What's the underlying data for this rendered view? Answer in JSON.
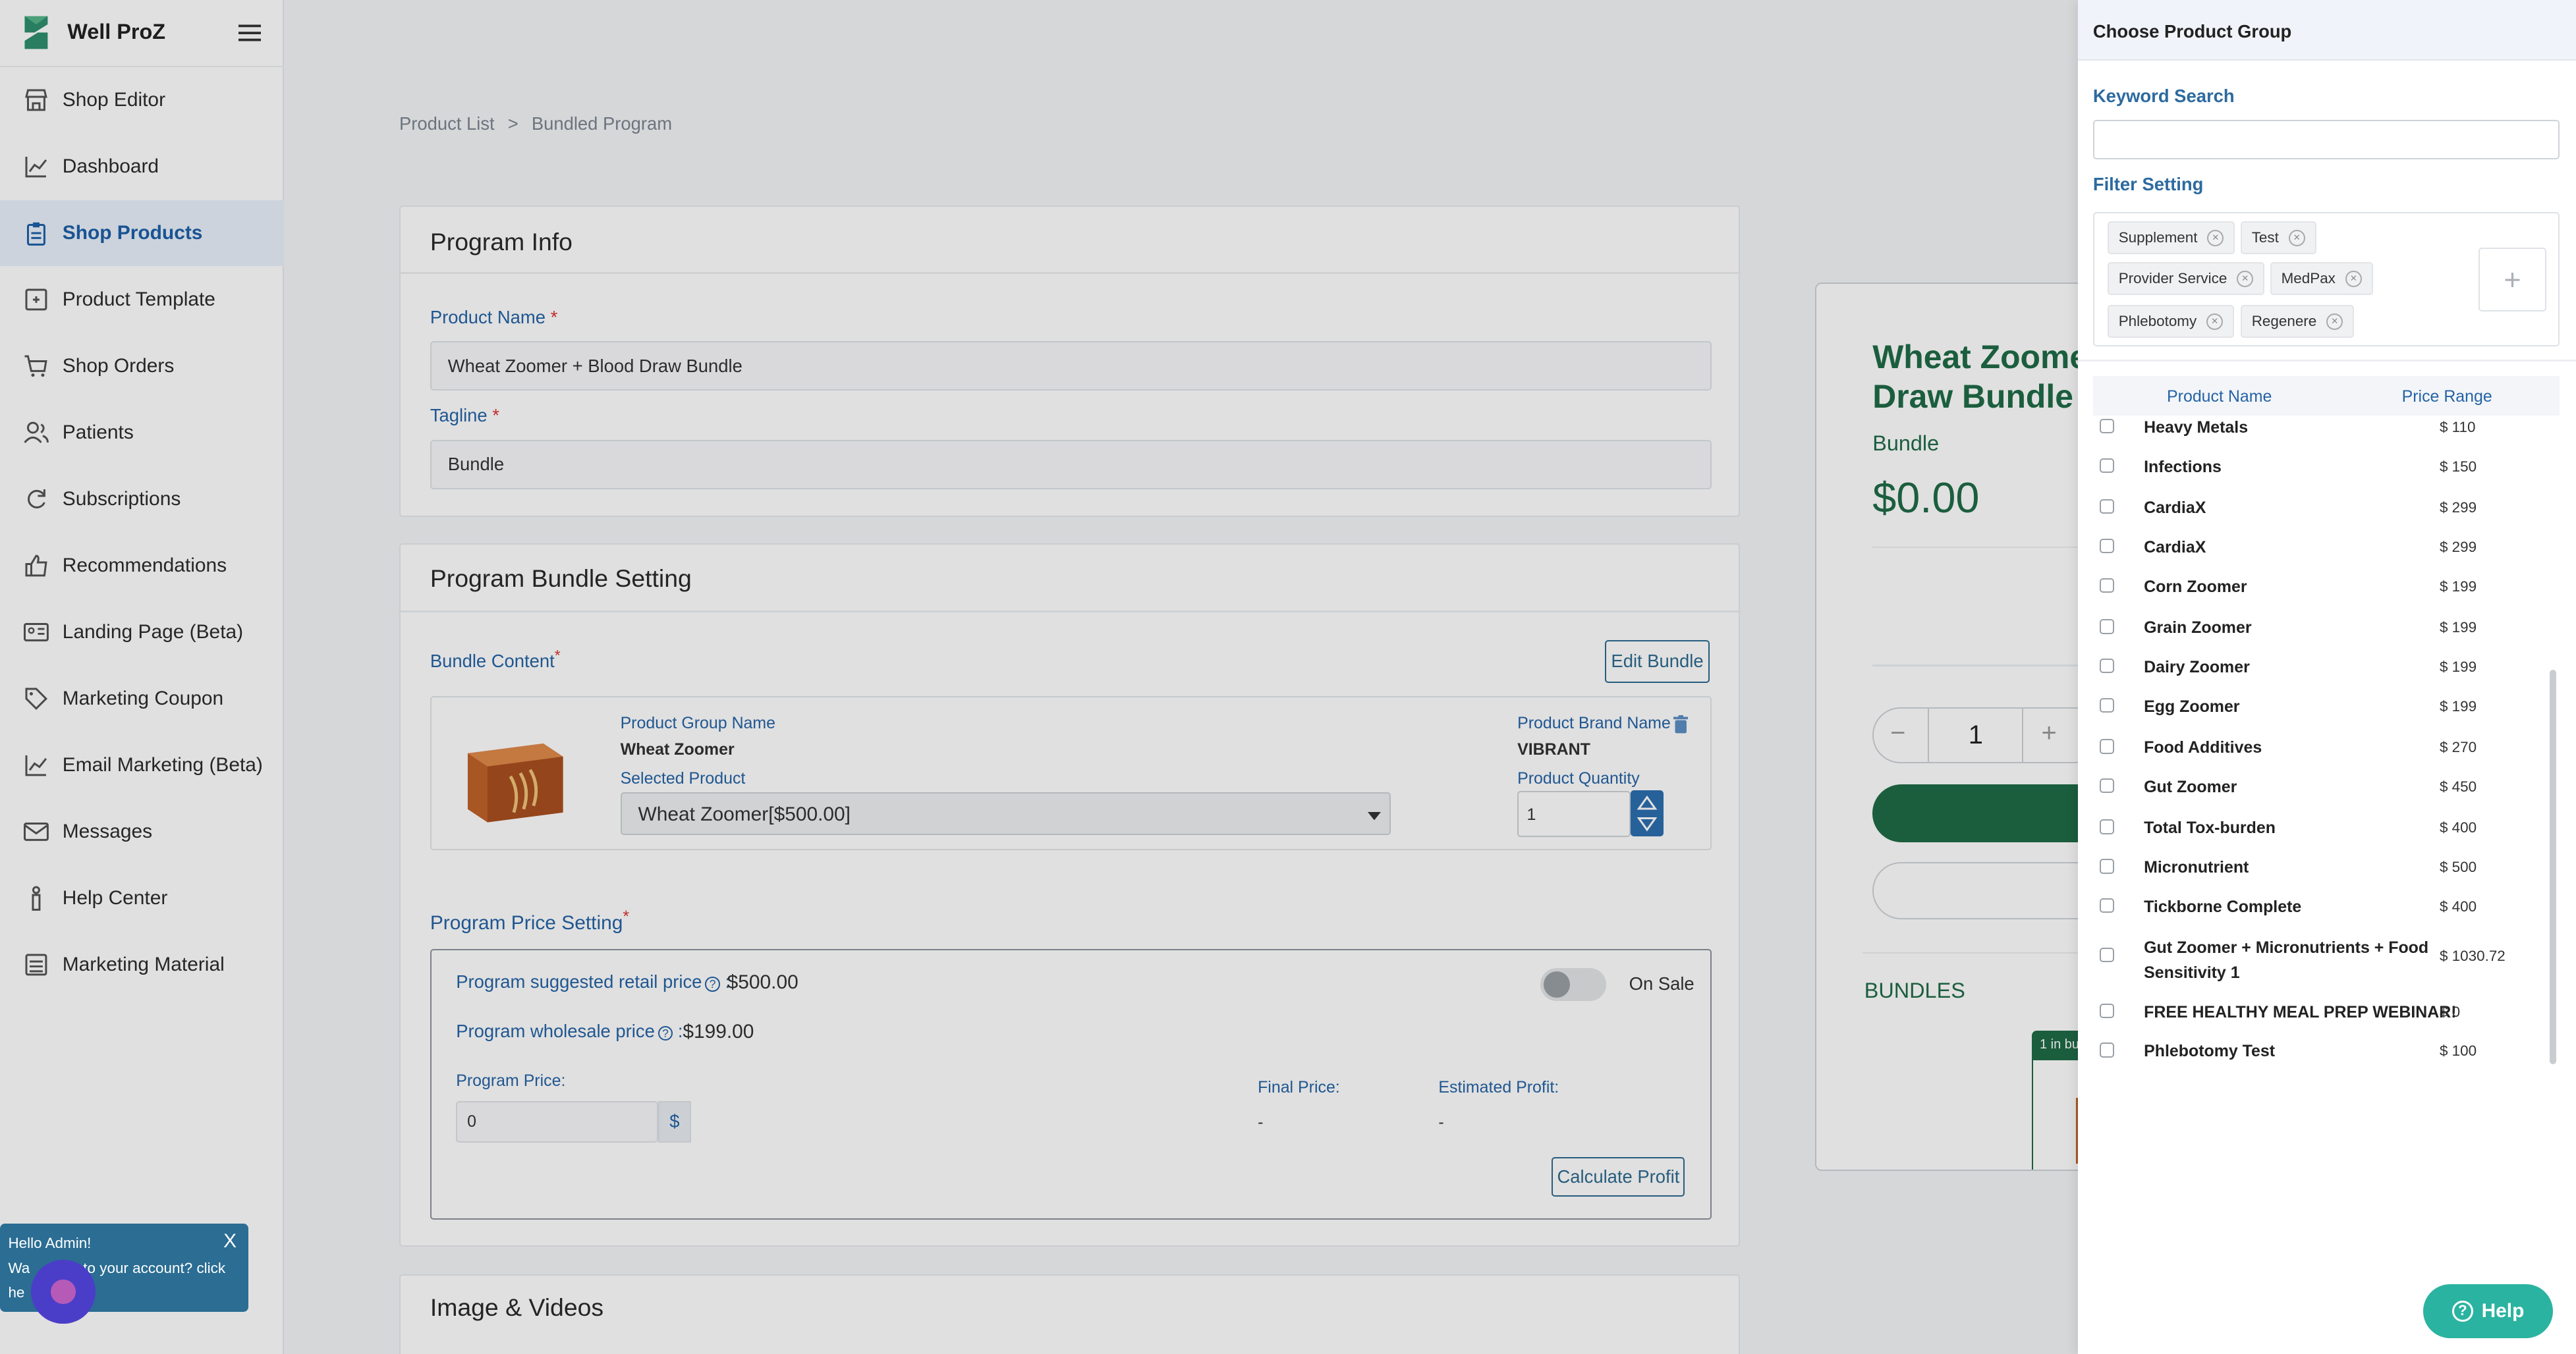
{
  "brand": {
    "name": "Well ProZ"
  },
  "sidebar": {
    "items": [
      {
        "label": "Shop Editor",
        "icon": "store-icon"
      },
      {
        "label": "Dashboard",
        "icon": "chart-line-icon"
      },
      {
        "label": "Shop Products",
        "icon": "clipboard-icon",
        "active": true
      },
      {
        "label": "Product Template",
        "icon": "template-icon"
      },
      {
        "label": "Shop Orders",
        "icon": "cart-icon"
      },
      {
        "label": "Patients",
        "icon": "users-icon"
      },
      {
        "label": "Subscriptions",
        "icon": "refresh-icon"
      },
      {
        "label": "Recommendations",
        "icon": "thumbs-up-icon"
      },
      {
        "label": "Landing Page (Beta)",
        "icon": "id-card-icon"
      },
      {
        "label": "Marketing Coupon",
        "icon": "tag-icon"
      },
      {
        "label": "Email Marketing (Beta)",
        "icon": "chart-line-icon"
      },
      {
        "label": "Messages",
        "icon": "mail-icon"
      },
      {
        "label": "Help Center",
        "icon": "person-help-icon"
      },
      {
        "label": "Marketing Material",
        "icon": "list-icon"
      }
    ]
  },
  "breadcrumb": {
    "root": "Product List",
    "sep": ">",
    "current": "Bundled Program"
  },
  "program_info": {
    "title": "Program Info",
    "product_name_label": "Product Name",
    "product_name_value": "Wheat Zoomer + Blood Draw Bundle",
    "tagline_label": "Tagline",
    "tagline_value": "Bundle",
    "required_mark": "*"
  },
  "bundle_setting": {
    "title": "Program Bundle Setting",
    "bundle_content_label": "Bundle Content",
    "edit_bundle": "Edit Bundle",
    "group_name_label": "Product Group Name",
    "group_name_value": "Wheat Zoomer",
    "selected_product_label": "Selected Product",
    "selected_product_value": "Wheat Zoomer[$500.00]",
    "brand_name_label": "Product Brand Name",
    "brand_name_value": "VIBRANT",
    "quantity_label": "Product Quantity",
    "quantity_value": "1"
  },
  "price_setting": {
    "title": "Program Price Setting",
    "retail_label": "Program suggested retail price",
    "retail_value": "$500.00",
    "on_sale_label": "On Sale",
    "wholesale_label": "Program wholesale price",
    "wholesale_value": "$199.00",
    "program_price_label": "Program Price:",
    "program_price_value": "0",
    "currency": "$",
    "final_price_label": "Final Price:",
    "final_price_value": "-",
    "estimated_profit_label": "Estimated Profit:",
    "estimated_profit_value": "-",
    "calculate_button": "Calculate Profit",
    "colon": ":"
  },
  "images": {
    "title": "Image & Videos"
  },
  "preview": {
    "title": "Wheat Zoomer + Blood Draw Bundle",
    "subtitle": "Bundle",
    "price": "$0.00",
    "qty": "1",
    "bundles_label": "BUNDLES",
    "badge": "1 in bu"
  },
  "panel": {
    "title": "Choose Product Group",
    "keyword_label": "Keyword Search",
    "keyword_value": "",
    "filter_label": "Filter Setting",
    "tags": [
      "Supplement",
      "Test",
      "Provider Service",
      "MedPax",
      "Phlebotomy",
      "Regenere"
    ],
    "add_symbol": "+",
    "col_name": "Product Name",
    "col_price": "Price Range",
    "rows": [
      {
        "name": "Heavy Metals",
        "price": "$ 110"
      },
      {
        "name": "Infections",
        "price": "$ 150"
      },
      {
        "name": "CardiaX",
        "price": "$ 299"
      },
      {
        "name": "CardiaX",
        "price": "$ 299"
      },
      {
        "name": "Corn Zoomer",
        "price": "$ 199"
      },
      {
        "name": "Grain Zoomer",
        "price": "$ 199"
      },
      {
        "name": "Dairy Zoomer",
        "price": "$ 199"
      },
      {
        "name": "Egg Zoomer",
        "price": "$ 199"
      },
      {
        "name": "Food Additives",
        "price": "$ 270"
      },
      {
        "name": "Gut Zoomer",
        "price": "$ 450"
      },
      {
        "name": "Total Tox-burden",
        "price": "$ 400"
      },
      {
        "name": "Micronutrient",
        "price": "$ 500"
      },
      {
        "name": "Tickborne Complete",
        "price": "$ 400"
      },
      {
        "name": "Gut Zoomer + Micronutrients + Food Sensitivity 1",
        "price": "$ 1030.72"
      },
      {
        "name": "FREE HEALTHY MEAL PREP WEBINAR!",
        "price": "$ 0"
      },
      {
        "name": "Phlebotomy Test",
        "price": "$ 100"
      }
    ]
  },
  "help": {
    "label": "Help",
    "symbol": "?"
  },
  "greeting": {
    "title": "Hello Admin!",
    "close": "X",
    "line1": "Wa",
    "line1b": "ck to your account? click",
    "line2": "he"
  }
}
